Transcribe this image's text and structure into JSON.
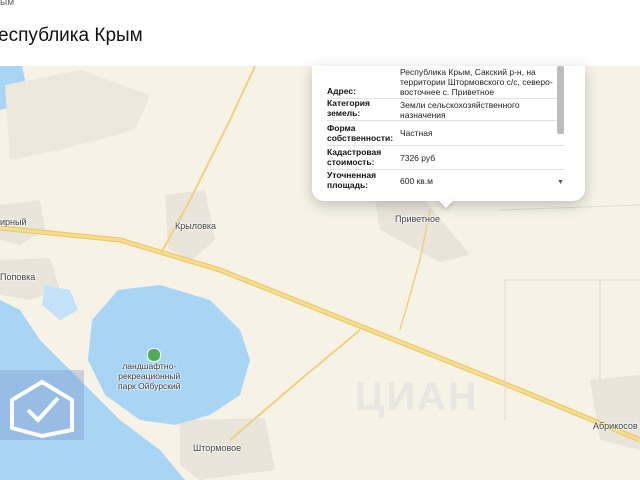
{
  "header": {
    "breadcrumb": "ым",
    "title": "еспублика Крым"
  },
  "popup": {
    "rows": [
      {
        "label": "Адрес:",
        "value": "Республика Крым, Сакский р-н, на территории Штормовского с/с, северо-восточнее с. Приветное"
      },
      {
        "label": "Категория земель:",
        "value": "Земли сельскохозяйственного назначения"
      },
      {
        "label": "Форма собственности:",
        "value": "Частная"
      },
      {
        "label": "Кадастровая стоимость:",
        "value": "7326 руб"
      },
      {
        "label": "Уточненная площадь:",
        "value": "600 кв.м"
      }
    ],
    "scroll_down_glyph": "▼"
  },
  "map": {
    "labels": {
      "privetnoe": "Приветное",
      "krylovka": "Крыловка",
      "mirny": "ирный",
      "popovka": "Поповка",
      "park": "ландшафтно-\nрекреационный\nпарк Ойбурский",
      "shtormovoe": "Штормовое",
      "abrikosovka": "Абрикосов"
    },
    "colors": {
      "land": "#f6f3e6",
      "water": "#a9d5f5",
      "settlement": "#e9e5da",
      "road": "#f7dd8a",
      "road_edge": "#e6c667",
      "park_icon": "#4caf50"
    }
  },
  "watermark": {
    "text": "ЦИАН"
  }
}
